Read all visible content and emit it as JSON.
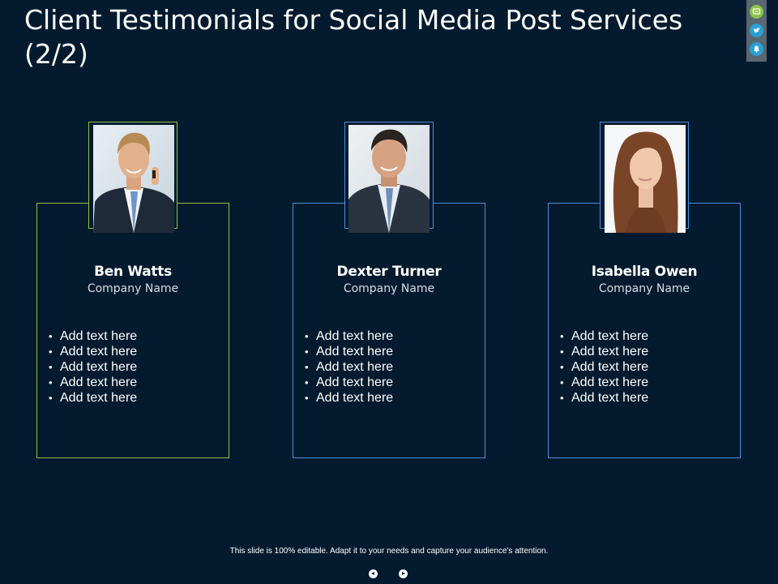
{
  "slide": {
    "title": "Client Testimonials for Social Media Post Services (2/2)",
    "footer": "This slide is 100% editable. Adapt it to your needs and capture your audience's attention."
  },
  "social": [
    {
      "icon": "chat-icon",
      "color": "#8bc34a"
    },
    {
      "icon": "twitter-icon",
      "color": "#2a9fd6"
    },
    {
      "icon": "notification-icon",
      "color": "#2a9fd6"
    }
  ],
  "colors": {
    "background": "#041a2e",
    "card1_border": "#8bc34a",
    "card2_border": "#4a90d9",
    "card3_border": "#4a90d9"
  },
  "testimonials": [
    {
      "name": "Ben Watts",
      "company": "Company Name",
      "bullets": [
        "Add text here",
        "Add text here",
        "Add text here",
        "Add text here",
        "Add text here"
      ]
    },
    {
      "name": "Dexter Turner",
      "company": "Company Name",
      "bullets": [
        "Add text here",
        "Add text here",
        "Add text here",
        "Add text here",
        "Add text here"
      ]
    },
    {
      "name": "Isabella Owen",
      "company": "Company Name",
      "bullets": [
        "Add text here",
        "Add text here",
        "Add text here",
        "Add text here",
        "Add text here"
      ]
    }
  ]
}
